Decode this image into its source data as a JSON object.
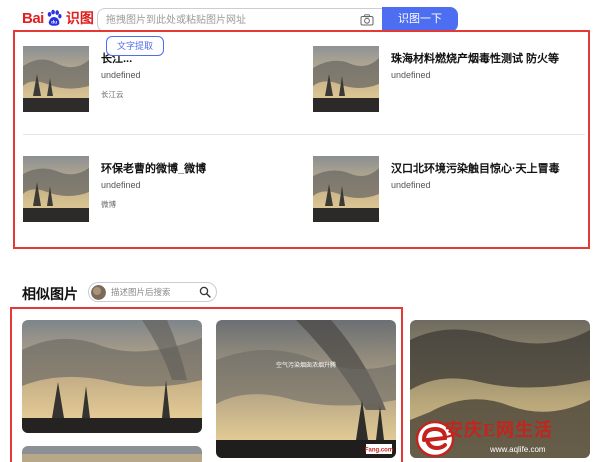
{
  "header": {
    "logo_text": "Bai",
    "logo_badge": "du",
    "logo_sub": "识图",
    "search_placeholder": "拖拽图片到此处或粘贴图片网址",
    "search_button": "识图一下"
  },
  "results": {
    "ocr_button": "文字提取",
    "cards": [
      {
        "title": "长江...",
        "subtitle": "undefined",
        "source": "长江云"
      },
      {
        "title": "珠海材料燃烧产烟毒性测试 防火等",
        "subtitle": "undefined",
        "source": ""
      },
      {
        "title": "环保老曹的微博_微博",
        "subtitle": "undefined",
        "source": "微博"
      },
      {
        "title": "汉口北环境污染触目惊心·天上冒毒",
        "subtitle": "undefined",
        "source": ""
      }
    ]
  },
  "similar": {
    "title": "相似图片",
    "search_placeholder": "描述图片后搜索",
    "caption": "空气污染烟囱浓烟升腾",
    "badge_text": "Fang.com"
  },
  "watermark": {
    "brand": "安庆E网生活",
    "url": "www.aqlife.com"
  },
  "colors": {
    "accent": "#4e6ef2",
    "highlight_border": "#e53935",
    "logo_red": "#e02020"
  }
}
